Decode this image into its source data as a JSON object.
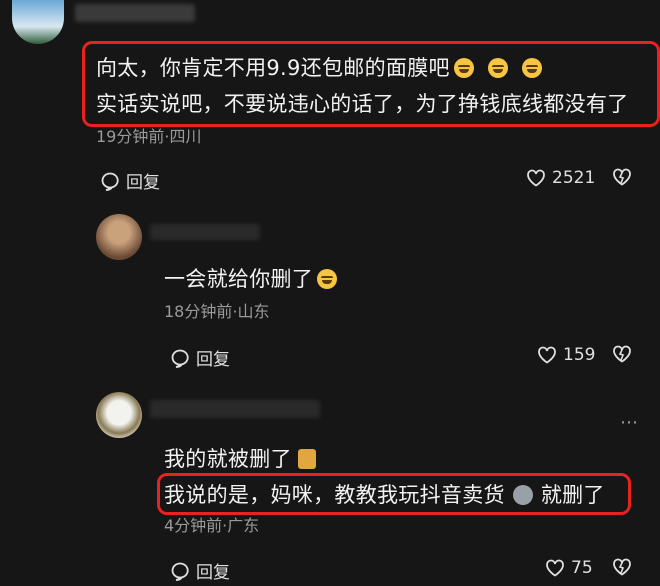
{
  "comments": [
    {
      "text_line1": "向太，你肯定不用9.9还包邮的面膜吧",
      "text_line2": "实话实说吧，不要说违心的话了，为了挣钱底线都没有了",
      "meta": "19分钟前·四川",
      "reply_label": "回复",
      "likes": "2521"
    },
    {
      "text": "一会就给你删了",
      "meta": "18分钟前·山东",
      "reply_label": "回复",
      "likes": "159"
    },
    {
      "text_line1": "我的就被删了",
      "text_line2": "我说的是，妈咪，教教我玩抖音卖货",
      "text_line2_suffix": "就删了",
      "meta": "4分钟前·广东",
      "reply_label": "回复",
      "likes": "75"
    }
  ],
  "colors": {
    "background": "#161616",
    "highlight": "#e8221e",
    "meta": "#9a9a9a"
  },
  "icons": [
    "reply-icon",
    "heart-icon",
    "broken-heart-icon",
    "more-icon",
    "laugh-emoji-icon"
  ]
}
